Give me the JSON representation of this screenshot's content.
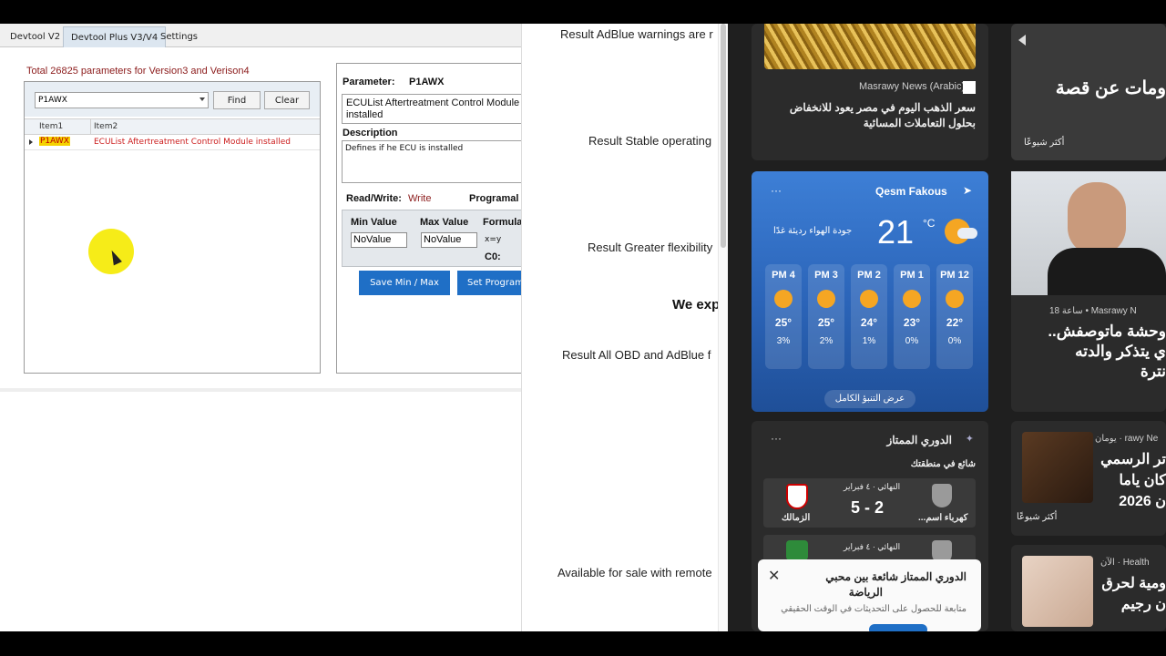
{
  "devtool": {
    "tabs": [
      "Devtool V2",
      "Devtool Plus V3/V4",
      "Settings"
    ],
    "total_label": "Total 26825 parameters for Version3 and Verison4",
    "search_value": "P1AWX",
    "find_label": "Find",
    "clear_label": "Clear",
    "columns": [
      "Item1",
      "Item2"
    ],
    "row": {
      "param": "P1AWX",
      "desc": "ECUList Aftertreatment Control Module installed"
    },
    "detail": {
      "parameter_label": "Parameter:",
      "parameter_value": "P1AWX",
      "name_text": "ECUList Aftertreatment Control Module installed",
      "description_label": "Description",
      "description_text": "Defines if he ECU is installed",
      "readwrite_label": "Read/Write:",
      "readwrite_value": "Write",
      "programable_label": "Programal",
      "min_label": "Min Value",
      "max_label": "Max Value",
      "formula_label": "Formula",
      "min_value": "NoValue",
      "max_value": "NoValue",
      "formula_value": "x=y",
      "c0_label": "C0:",
      "save_btn": "Save Min / Max",
      "set_btn": "Set Programa"
    }
  },
  "document": {
    "lines": [
      "Result AdBlue warnings are r",
      "Result Stable operating",
      "Result Greater flexibility",
      "We exp",
      "Result All OBD and AdBlue f",
      "Available for sale with remote"
    ]
  },
  "widgets": {
    "news1": {
      "source": "Masrawy News (Arabic)",
      "headline_1": "سعر الذهب اليوم في مصر يعود للانخفاض",
      "headline_2": "بحلول التعاملات المسائية"
    },
    "news2": {
      "headline": "ومات عن قصة",
      "trending": "أكثر شيوعًا"
    },
    "weather": {
      "location": "Qesm Fakous",
      "temp": "21",
      "unit": "°C",
      "air_quality": "جودة الهواء رديئة غدًا",
      "hours": [
        {
          "label": "PM 4",
          "temp": "25°",
          "precip": "3%"
        },
        {
          "label": "PM 3",
          "temp": "25°",
          "precip": "2%"
        },
        {
          "label": "PM 2",
          "temp": "24°",
          "precip": "1%"
        },
        {
          "label": "PM 1",
          "temp": "23°",
          "precip": "0%"
        },
        {
          "label": "PM 12",
          "temp": "22°",
          "precip": "0%"
        }
      ],
      "forecast_btn": "عرض التنبؤ الكامل"
    },
    "news3": {
      "meta": "18 ساعة • Masrawy N",
      "line1": "وحشة ماتوصفش..",
      "line2": "ي يتذكر والدته",
      "line3": "نترة"
    },
    "league": {
      "title": "الدوري الممتاز",
      "subtitle": "شائع في منطقتك",
      "match1": {
        "status": "النهائي · ٤ فبراير",
        "score": "2 - 5",
        "home": "الزمالك",
        "away": "كهرباء اسم..."
      },
      "match2": {
        "status": "النهائي · ٤ فبراير"
      }
    },
    "news4": {
      "meta": "يومان · rawy Ne",
      "line1": "تر الرسمي",
      "line2": "كان ياما",
      "line3": "ن 2026",
      "trending": "أكثر شيوعًا"
    },
    "news5": {
      "meta": "الآن · Health",
      "line1": "ومية لحرق",
      "line2": "ن رجيم"
    },
    "toast": {
      "title": "الدوري الممتاز شائعة بين محبي",
      "title2": "الرياضة",
      "body": "متابعة للحصول على التحديثات في الوقت الحقيقي"
    }
  }
}
